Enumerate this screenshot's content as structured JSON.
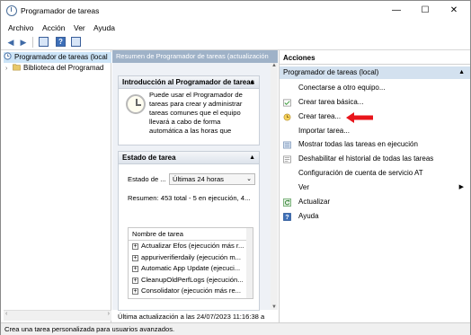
{
  "window": {
    "title": "Programador de tareas",
    "minimize": "—",
    "maximize": "☐",
    "close": "✕"
  },
  "menu": [
    "Archivo",
    "Acción",
    "Ver",
    "Ayuda"
  ],
  "toolbar": {
    "back": "◀",
    "forward": "▶",
    "help": "?"
  },
  "tree": {
    "items": [
      {
        "label": "Programador de tareas (local",
        "icon": "clock-icon",
        "selected": true
      },
      {
        "label": "Biblioteca del Programad",
        "icon": "folder-icon",
        "selected": false
      }
    ]
  },
  "center": {
    "header": "Resumen de Programador de tareas (actualización",
    "intro": {
      "title": "Introducción al Programador de tareas",
      "text": "Puede usar el Programador de tareas para crear y administrar tareas comunes que el equipo llevará a cabo de forma automática a las horas que especifique. Para"
    },
    "status": {
      "title": "Estado de tarea",
      "field_label": "Estado de ...",
      "select_value": "Últimas 24 horas",
      "summary": "Resumen: 453 total - 5 en ejecución, 4...",
      "list_header": "Nombre de tarea",
      "tasks": [
        "Actualizar Efos (ejecución más r...",
        "appuriverifierdaily (ejecución m...",
        "Automatic App Update (ejecuci...",
        "CleanupOldPerfLogs (ejecución...",
        "Consolidator (ejecución más re..."
      ]
    },
    "footer": "Última actualización a las 24/07/2023 11:16:38 a"
  },
  "actions": {
    "title": "Acciones",
    "group": "Programador de tareas (local)",
    "items": [
      {
        "label": "Conectarse a otro equipo...",
        "icon": "",
        "submenu": false
      },
      {
        "label": "Crear tarea básica...",
        "icon": "create-basic-task-icon",
        "submenu": false
      },
      {
        "label": "Crear tarea...",
        "icon": "create-task-icon",
        "submenu": false
      },
      {
        "label": "Importar tarea...",
        "icon": "",
        "submenu": false
      },
      {
        "label": "Mostrar todas las tareas en ejecución",
        "icon": "running-tasks-icon",
        "submenu": false
      },
      {
        "label": "Deshabilitar el historial de todas las tareas",
        "icon": "history-icon",
        "submenu": false
      },
      {
        "label": "Configuración de cuenta de servicio AT",
        "icon": "",
        "submenu": false
      },
      {
        "label": "Ver",
        "icon": "",
        "submenu": true
      },
      {
        "label": "Actualizar",
        "icon": "refresh-icon",
        "submenu": false
      },
      {
        "label": "Ayuda",
        "icon": "help-icon",
        "submenu": false
      }
    ]
  },
  "status_bar": "Crea una tarea personalizada para usuarios avanzados.",
  "colors": {
    "header_bg": "#9fb2c8",
    "selection": "#d3e1ef",
    "annotation_arrow": "#e8151b"
  }
}
